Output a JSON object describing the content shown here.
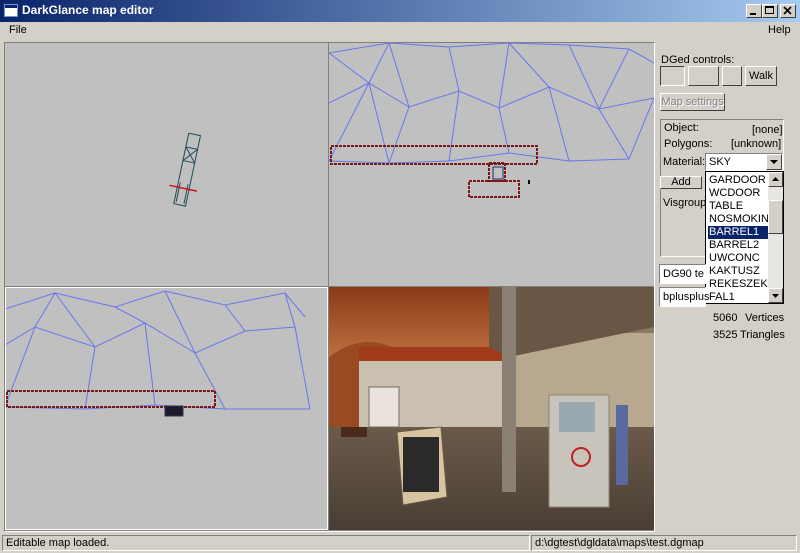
{
  "window": {
    "title": "DarkGlance map editor"
  },
  "menu": {
    "file": "File",
    "help": "Help"
  },
  "panel": {
    "dged_label": "DGed controls:",
    "walk_button": "Walk",
    "map_settings_button": "Map settings",
    "object_label": "Object:",
    "object_value": "[none]",
    "polygons_label": "Polygons:",
    "polygons_value": "[unknown]",
    "material_label": "Material:",
    "material_value": "SKY",
    "add_button": "Add",
    "visgroups_label": "Visgroup",
    "materials": [
      "GARDOOR",
      "WCDOOR",
      "TABLE",
      "NOSMOKING",
      "BARREL1",
      "BARREL2",
      "UWCONC",
      "KAKTUSZ",
      "REKESZEK",
      "FAL1"
    ],
    "selected_material_index": 4,
    "texture_combo": "DG90 te",
    "plugin_combo": "bplusplus",
    "vertices_count": "5060",
    "vertices_label": "Vertices",
    "triangles_count": "3525",
    "triangles_label": "Triangles"
  },
  "status": {
    "message": "Editable map loaded.",
    "path": "d:\\dgtest\\dgldata\\maps\\test.dgmap"
  },
  "colors": {
    "titlebar_start": "#0a246a",
    "titlebar_end": "#a6caf0",
    "wireframe": "#6677ee",
    "mesh": "#7a1818",
    "selection": "#0a246a"
  },
  "icons": {
    "app": "app-window-icon",
    "minimize": "minimize-icon",
    "maximize": "maximize-icon",
    "close": "close-icon",
    "dropdown": "chevron-down-icon",
    "scroll_up": "scroll-up-icon",
    "scroll_down": "scroll-down-icon"
  }
}
